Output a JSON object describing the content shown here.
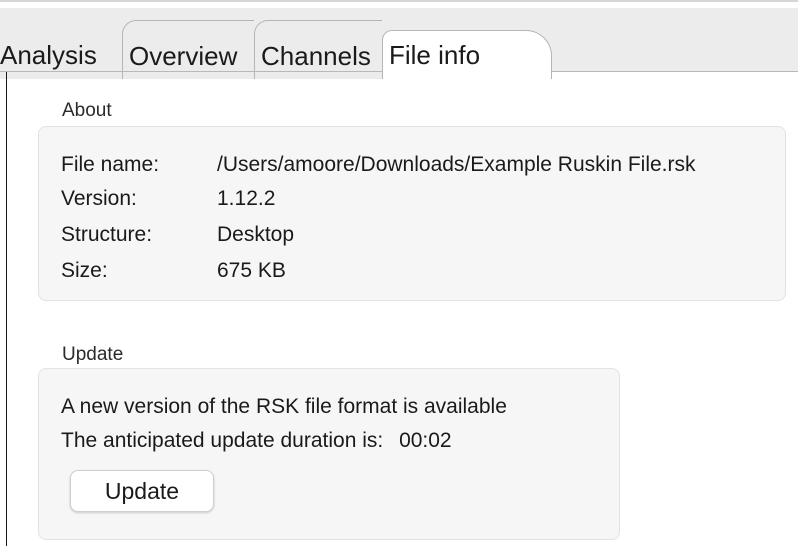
{
  "tabs": [
    {
      "label": "Analysis"
    },
    {
      "label": "Overview"
    },
    {
      "label": "Channels"
    },
    {
      "label": "File info"
    }
  ],
  "about": {
    "heading": "About",
    "rows": [
      {
        "key": "File name:",
        "value": "/Users/amoore/Downloads/Example Ruskin File.rsk"
      },
      {
        "key": "Version:",
        "value": "1.12.2"
      },
      {
        "key": "Structure:",
        "value": "Desktop"
      },
      {
        "key": "Size:",
        "value": "675 KB"
      }
    ]
  },
  "update": {
    "heading": "Update",
    "message": "A new version of the RSK file format is available",
    "duration_label": "The anticipated update duration is:",
    "duration_value": "00:02",
    "button_label": "Update"
  }
}
